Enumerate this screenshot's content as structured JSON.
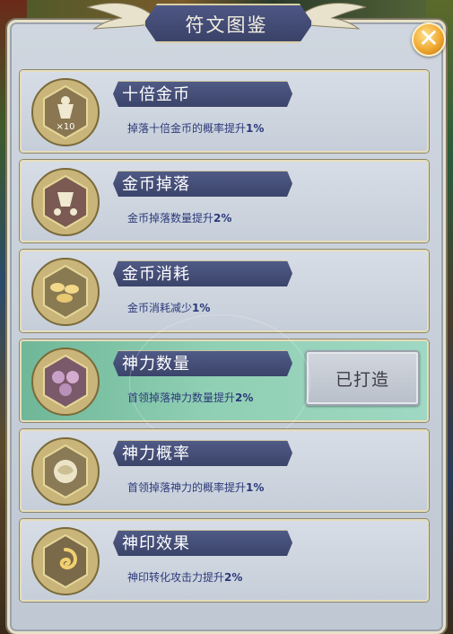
{
  "window": {
    "title": "符文图鉴"
  },
  "close_icon": "close-icon",
  "runes": [
    {
      "name": "十倍金币",
      "desc_prefix": "掉落十倍金币的概率提升",
      "desc_value": "1%",
      "icon": "coin-bag-x10-icon",
      "icon_badge": "×10",
      "active": false
    },
    {
      "name": "金币掉落",
      "desc_prefix": "金币掉落数量提升",
      "desc_value": "2%",
      "icon": "coin-drop-icon",
      "active": false
    },
    {
      "name": "金币消耗",
      "desc_prefix": "金币消耗减少",
      "desc_value": "1%",
      "icon": "coin-pile-icon",
      "active": false
    },
    {
      "name": "神力数量",
      "desc_prefix": "首领掉落神力数量提升",
      "desc_value": "2%",
      "icon": "divine-orbs-icon",
      "active": true,
      "button": "已打造"
    },
    {
      "name": "神力概率",
      "desc_prefix": "首领掉落神力的概率提升",
      "desc_value": "1%",
      "icon": "divine-orb-icon",
      "active": false
    },
    {
      "name": "神印效果",
      "desc_prefix": "神印转化攻击力提升",
      "desc_value": "2%",
      "icon": "swirl-seal-icon",
      "active": false
    }
  ],
  "colors": {
    "name_plate": "#3b446a",
    "description": "#2b3a7a",
    "active_row": "#8fcfb3",
    "close_button": "#f0a930"
  }
}
